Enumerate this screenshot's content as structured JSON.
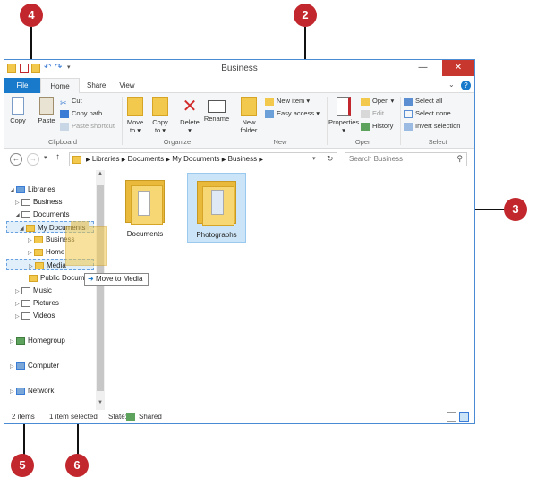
{
  "window": {
    "title": "Business"
  },
  "tabs": [
    "File",
    "Home",
    "Share",
    "View"
  ],
  "ribbon": {
    "clipboard": {
      "label": "Clipboard",
      "copy": "Copy",
      "paste": "Paste",
      "cut": "Cut",
      "copy_path": "Copy path",
      "paste_shortcut": "Paste shortcut"
    },
    "organize": {
      "label": "Organize",
      "move_to_1": "Move",
      "move_to_2": "to",
      "copy_to_1": "Copy",
      "copy_to_2": "to",
      "delete": "Delete",
      "rename": "Rename"
    },
    "new": {
      "label": "New",
      "new_folder_1": "New",
      "new_folder_2": "folder",
      "new_item": "New item",
      "easy_access": "Easy access"
    },
    "open": {
      "label": "Open",
      "properties": "Properties",
      "open": "Open",
      "edit": "Edit",
      "history": "History"
    },
    "select": {
      "label": "Select",
      "select_all": "Select all",
      "select_none": "Select none",
      "invert_selection": "Invert selection"
    }
  },
  "address": {
    "crumbs": [
      "Libraries",
      "Documents",
      "My Documents",
      "Business"
    ],
    "search_placeholder": "Search Business"
  },
  "nav": {
    "libraries": "Libraries",
    "business": "Business",
    "documents": "Documents",
    "my_documents": "My Documents",
    "business_sub": "Business",
    "home": "Home",
    "media": "Media",
    "public_documents": "Public Documents",
    "music": "Music",
    "pictures": "Pictures",
    "videos": "Videos",
    "homegroup": "Homegroup",
    "computer": "Computer",
    "network": "Network"
  },
  "content": {
    "items": [
      {
        "name": "Documents"
      },
      {
        "name": "Photographs"
      }
    ]
  },
  "drag_tooltip": "Move to Media",
  "status": {
    "count": "2 items",
    "selected": "1 item selected",
    "state_label": "State:",
    "state_value": "Shared"
  },
  "callouts": [
    "2",
    "3",
    "4",
    "5",
    "6"
  ],
  "colors": {
    "accent": "#1979ca",
    "close": "#c8372d",
    "callout": "#c1272d",
    "selection": "#cce4f7"
  }
}
